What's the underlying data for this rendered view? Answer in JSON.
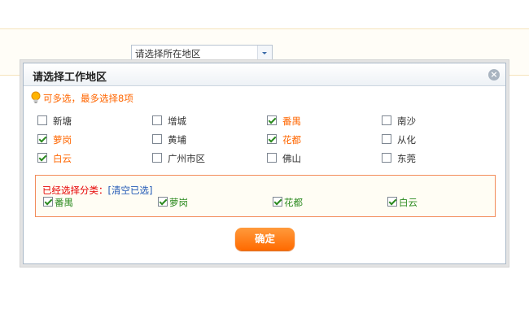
{
  "page": {
    "region_select": {
      "value": "请选择所在地区"
    }
  },
  "dialog": {
    "title": "请选择工作地区",
    "close_label": "×",
    "hint": "可多选，最多选择8项",
    "options": [
      {
        "label": "新塘",
        "checked": false
      },
      {
        "label": "增城",
        "checked": false
      },
      {
        "label": "番禺",
        "checked": true
      },
      {
        "label": "南沙",
        "checked": false
      },
      {
        "label": "萝岗",
        "checked": true
      },
      {
        "label": "黄埔",
        "checked": false
      },
      {
        "label": "花都",
        "checked": true
      },
      {
        "label": "从化",
        "checked": false
      },
      {
        "label": "白云",
        "checked": true
      },
      {
        "label": "广州市区",
        "checked": false
      },
      {
        "label": "佛山",
        "checked": false
      },
      {
        "label": "东莞",
        "checked": false
      }
    ],
    "selected_panel": {
      "title": "已经选择分类：",
      "clear_label": "[清空已选]",
      "items": [
        "番禺",
        "萝岗",
        "花都",
        "白云"
      ]
    },
    "confirm_label": "确定"
  },
  "colors": {
    "accent": "#ff6600",
    "selected_green": "#2b8a1f",
    "link_blue": "#1f57b5",
    "panel_border": "#f28c5a"
  }
}
